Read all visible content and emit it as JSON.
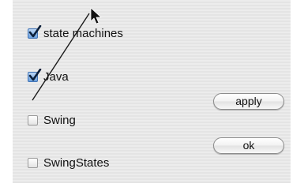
{
  "options": [
    {
      "label": "state machines",
      "checked": true
    },
    {
      "label": "Java",
      "checked": true
    },
    {
      "label": "Swing",
      "checked": false
    },
    {
      "label": "SwingStates",
      "checked": false
    }
  ],
  "buttons": {
    "apply_label": "apply",
    "ok_label": "ok"
  },
  "icons": {
    "checkmark": "checkmark-icon",
    "cursor": "arrow-cursor-icon"
  },
  "colors": {
    "checkbox_checked": "#6aa0dd",
    "checkmark": "#0b1f3a",
    "stroke": "#1a1a1a"
  }
}
